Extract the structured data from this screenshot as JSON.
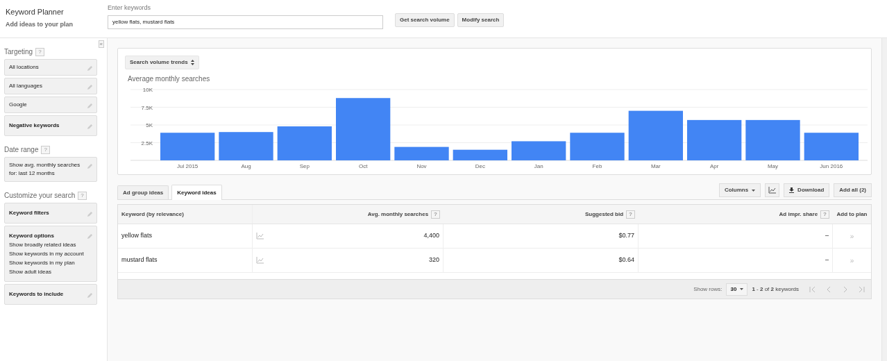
{
  "header": {
    "title": "Keyword Planner",
    "subtitle": "Add ideas to your plan",
    "keywords_label": "Enter keywords",
    "keywords_value": "yellow flats, mustard flats",
    "buttons": [
      "Get search volume",
      "Modify search"
    ]
  },
  "sidebar": {
    "collapse": "«",
    "sections": [
      {
        "title": "Targeting",
        "help": "?",
        "items": [
          {
            "kind": "plain",
            "label": "All locations"
          },
          {
            "kind": "plain",
            "label": "All languages"
          },
          {
            "kind": "plain",
            "label": "Google"
          },
          {
            "kind": "bold",
            "label": "Negative keywords"
          }
        ]
      },
      {
        "title": "Date range",
        "help": "?",
        "items": [
          {
            "kind": "plain",
            "label": "Show avg. monthly searches for: last 12 months"
          }
        ]
      },
      {
        "title": "Customize your search",
        "help": "?",
        "items": [
          {
            "kind": "bold",
            "label": "Keyword filters"
          },
          {
            "kind": "detail",
            "label": "Keyword options",
            "lines": [
              "Show broadly related ideas",
              "Show keywords in my account",
              "Show keywords in my plan",
              "Show adult ideas"
            ]
          },
          {
            "kind": "bold",
            "label": "Keywords to include"
          }
        ]
      }
    ]
  },
  "trend_selector": "Search volume trends",
  "chart_data": {
    "type": "bar",
    "title": "Average monthly searches",
    "categories": [
      "Jul 2015",
      "Aug",
      "Sep",
      "Oct",
      "Nov",
      "Dec",
      "Jan",
      "Feb",
      "Mar",
      "Apr",
      "May",
      "Jun 2016"
    ],
    "values": [
      3900,
      4000,
      4800,
      8800,
      1900,
      1500,
      2700,
      3900,
      7000,
      5700,
      5700,
      3900
    ],
    "grid": true,
    "ylim": [
      0,
      10000
    ],
    "yticks": [
      {
        "value": 2500,
        "label": "2.5K"
      },
      {
        "value": 5000,
        "label": "5K"
      },
      {
        "value": 7500,
        "label": "7.5K"
      },
      {
        "value": 10000,
        "label": "10K"
      }
    ]
  },
  "tabs": [
    {
      "label": "Ad group ideas",
      "selected": false
    },
    {
      "label": "Keyword ideas",
      "selected": true
    }
  ],
  "toolbar": {
    "columns": "Columns",
    "download": "Download",
    "add_all": "Add all (2)"
  },
  "table": {
    "columns": [
      {
        "label": "Keyword (by relevance)"
      },
      {
        "label": "Avg. monthly searches",
        "help": "?"
      },
      {
        "label": "Suggested bid",
        "help": "?"
      },
      {
        "label": "Ad impr. share",
        "help": "?"
      },
      {
        "label": "Add to plan"
      }
    ],
    "rows": [
      {
        "keyword": "yellow flats",
        "searches": "4,400",
        "bid": "$0.77",
        "share": "–",
        "add": "»"
      },
      {
        "keyword": "mustard flats",
        "searches": "320",
        "bid": "$0.64",
        "share": "–",
        "add": "»"
      }
    ]
  },
  "footer": {
    "show_rows_label": "Show rows:",
    "rows_value": "30",
    "range": "**1** - **2** of **2** keywords"
  }
}
